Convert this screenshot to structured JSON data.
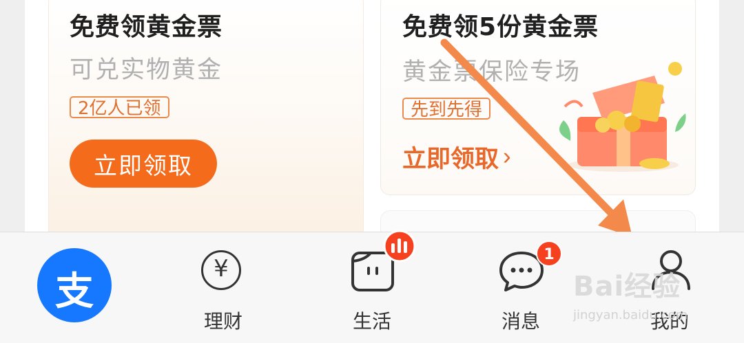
{
  "cards": {
    "left": {
      "title": "免费领黄金票",
      "subtitle": "可兑实物黄金",
      "tag": "2亿人已领",
      "button": "立即领取"
    },
    "right": {
      "title": "免费领5份黄金票",
      "subtitle": "黄金票保险专场",
      "tag": "先到先得",
      "button": "立即领取",
      "button_chevron": "›"
    }
  },
  "tabbar": {
    "items": [
      {
        "label": "",
        "icon": "alipay-logo-icon",
        "logo_text": "支"
      },
      {
        "label": "理财",
        "icon": "yen-circle-icon",
        "icon_text": "¥"
      },
      {
        "label": "生活",
        "icon": "life-app-icon"
      },
      {
        "label": "消息",
        "icon": "chat-bubble-icon",
        "badge": "1"
      },
      {
        "label": "我的",
        "icon": "person-icon"
      }
    ]
  },
  "watermark": {
    "brand": "Bai经验",
    "url": "jingyan.baidu.com"
  },
  "colors": {
    "accent": "#f36b1b",
    "brand_blue": "#1677ff",
    "badge_red": "#f5411f",
    "arrow": "#f3894a"
  }
}
